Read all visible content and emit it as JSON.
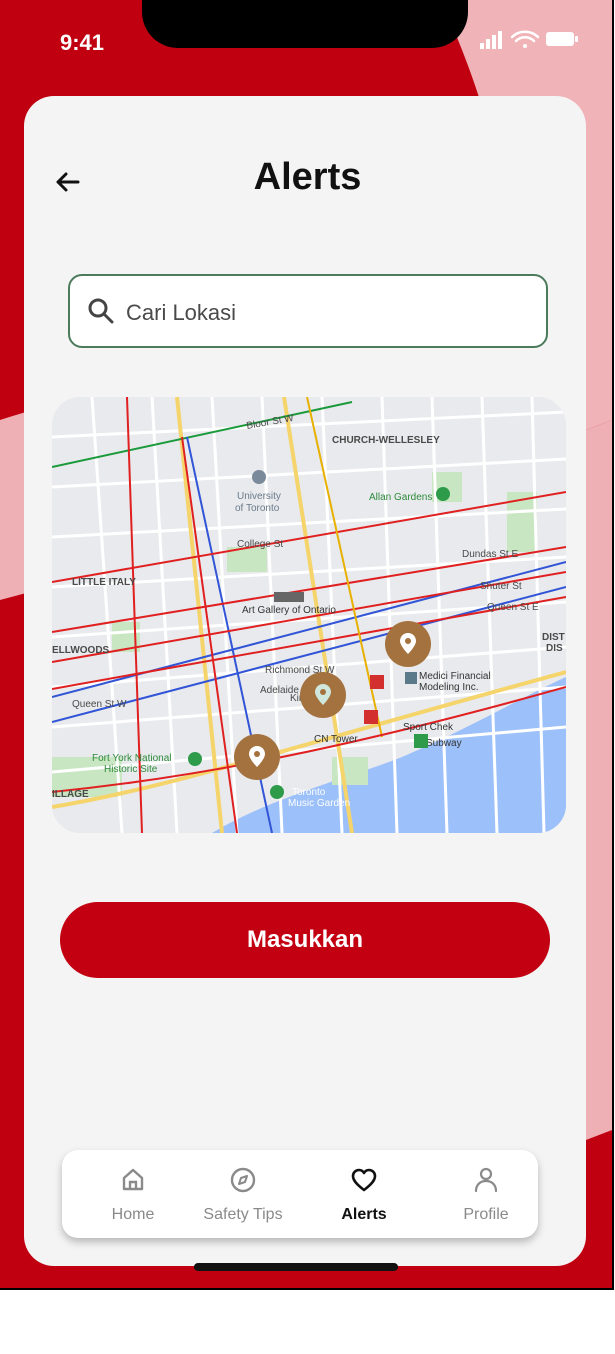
{
  "status_bar": {
    "time": "9:41"
  },
  "header": {
    "title": "Alerts"
  },
  "search": {
    "placeholder": "Cari Lokasi"
  },
  "map": {
    "labels": {
      "bloor": "Bloor St W",
      "church_wellesley": "CHURCH-WELLESLEY",
      "university": "University",
      "of_toronto": "of Toronto",
      "allan_gardens": "Allan Gardens",
      "college": "College St",
      "dundas": "Dundas St E",
      "little_italy": "LITTLE ITALY",
      "art_gallery": "Art Gallery of Ontario",
      "shuter": "Shuter St",
      "queen_e": "Queen St E",
      "dist": "DIST",
      "dis": "DIS",
      "ellwoods": "ELLWOODS",
      "richmond": "Richmond St W",
      "adelaide": "Adelaide St W",
      "king": "King St W",
      "queen_w": "Queen St W",
      "medici_1": "Medici Financial",
      "medici_2": "Modeling Inc.",
      "sport_chek": "Sport Chek",
      "subway": "Subway",
      "cn_tower": "CN Tower",
      "fort_york_1": "Fort York National",
      "fort_york_2": "Historic Site",
      "illage": "ILLAGE",
      "music_1": "Toronto",
      "music_2": "Music Garden"
    },
    "pin_color": "#a4723f"
  },
  "actions": {
    "submit_label": "Masukkan"
  },
  "bottom_nav": [
    {
      "label": "Home",
      "icon": "home-icon"
    },
    {
      "label": "Safety Tips",
      "icon": "compass-icon"
    },
    {
      "label": "Alerts",
      "icon": "heart-icon",
      "active": true
    },
    {
      "label": "Profile",
      "icon": "user-icon"
    }
  ],
  "colors": {
    "brand_red": "#c30011",
    "card_bg": "#f4f4f4",
    "search_border": "#4b7b5a"
  }
}
